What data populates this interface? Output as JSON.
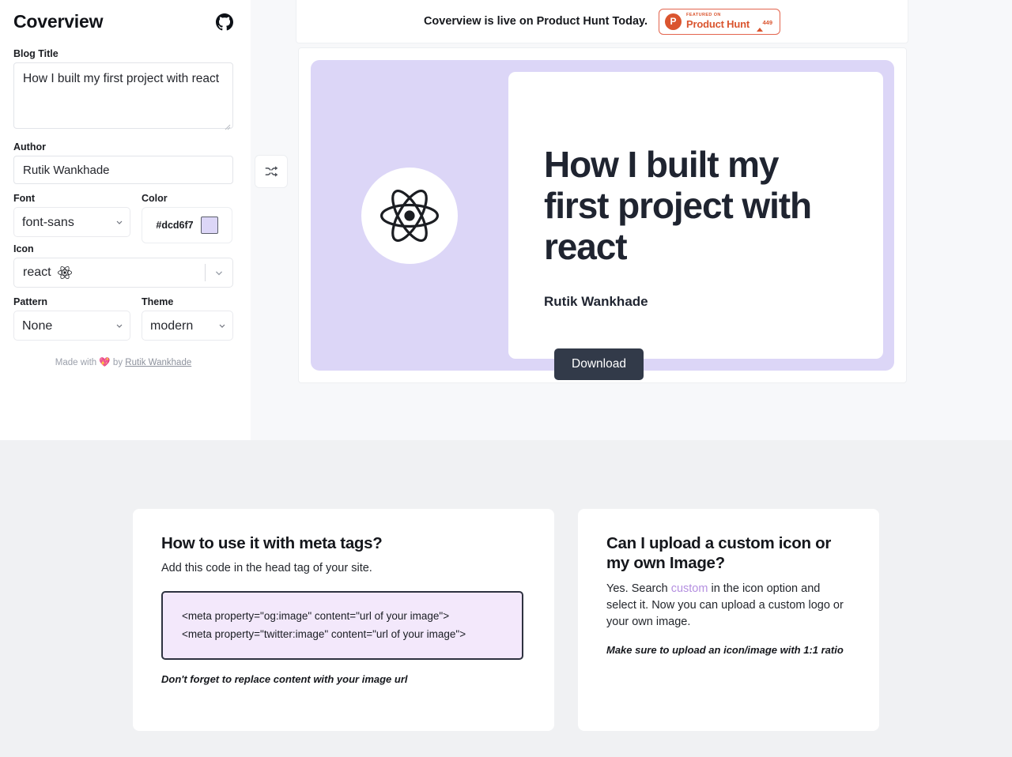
{
  "sidebar": {
    "brand": "Coverview",
    "github_icon": "github-icon",
    "fields": {
      "blog_title": {
        "label": "Blog Title",
        "value": "How I built my first project with react"
      },
      "author": {
        "label": "Author",
        "value": "Rutik Wankhade"
      },
      "font": {
        "label": "Font",
        "value": "font-sans"
      },
      "color": {
        "label": "Color",
        "value": "#dcd6f7"
      },
      "icon": {
        "label": "Icon",
        "value": "react"
      },
      "pattern": {
        "label": "Pattern",
        "value": "None"
      },
      "theme": {
        "label": "Theme",
        "value": "modern"
      }
    },
    "footer": {
      "prefix": "Made with",
      "heart": "💖",
      "middle": "by",
      "author_link": "Rutik Wankhade"
    }
  },
  "announcement": {
    "text": "Coverview is live on Product Hunt Today.",
    "badge": {
      "logo_letter": "P",
      "featured_on": "FEATURED ON",
      "name": "Product Hunt",
      "votes": "449"
    }
  },
  "preview": {
    "shuffle_icon": "shuffle-icon",
    "cover": {
      "background_color": "#dcd6f7",
      "title": "How I built my first project with react",
      "author": "Rutik Wankhade",
      "icon": "react-icon"
    },
    "download_label": "Download"
  },
  "faq": [
    {
      "title": "How to use it with meta tags?",
      "subtitle": "Add this code in the head tag of your site.",
      "code_line_1": "<meta property=\"og:image\" content=\"url of your image\">",
      "code_line_2": "<meta property=\"twitter:image\" content=\"url of your image\">",
      "note": "Don't forget to replace content with your image url"
    },
    {
      "title": "Can I upload a custom icon or my own Image?",
      "body_before": "Yes. Search ",
      "body_highlight": "custom",
      "body_after": " in the icon option and select it. Now you can upload a custom logo or your own image.",
      "note": "Make sure to upload an icon/image with 1:1 ratio"
    }
  ]
}
